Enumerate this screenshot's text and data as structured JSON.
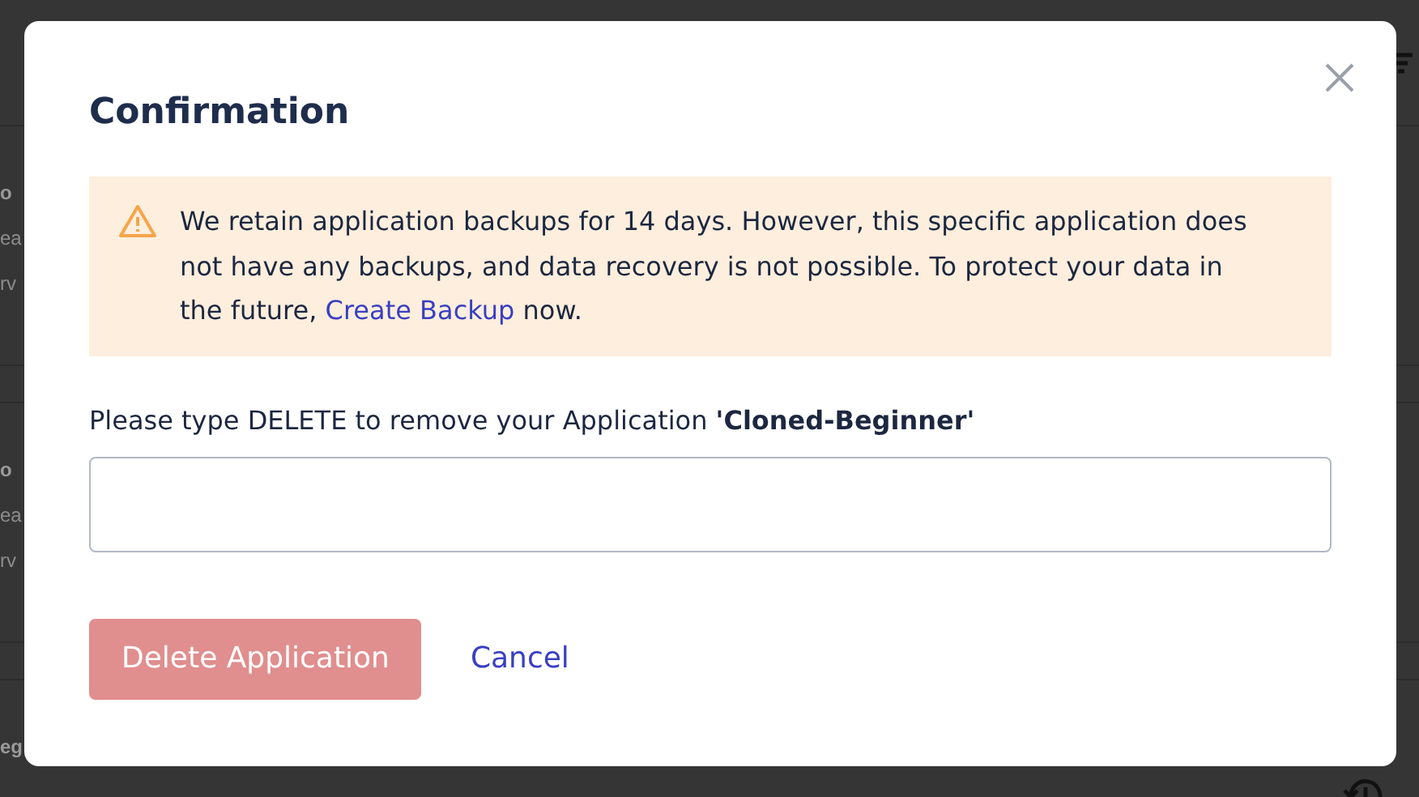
{
  "background": {
    "rows": [
      {
        "title": "o",
        "lines": [
          "ea",
          "rv"
        ]
      },
      {
        "title": "o",
        "lines": [
          "ea",
          "rv"
        ]
      },
      {
        "title": "eg"
      }
    ]
  },
  "dialog": {
    "title": "Confirmation",
    "alert": {
      "kind": "warning",
      "text_before": "We retain application backups for 14 days. However, this specific application does not have any backups, and data recovery is not possible. To protect your data in the future, ",
      "link": "Create Backup",
      "text_after": " now."
    },
    "prompt": "Please type DELETE to remove your Application **'Cloned-Beginner'**",
    "buttons": [
      {
        "kind": "primary",
        "label": "Delete Application",
        "disabled": true
      },
      {
        "kind": "link",
        "label": "Cancel",
        "disabled": false
      }
    ]
  }
}
